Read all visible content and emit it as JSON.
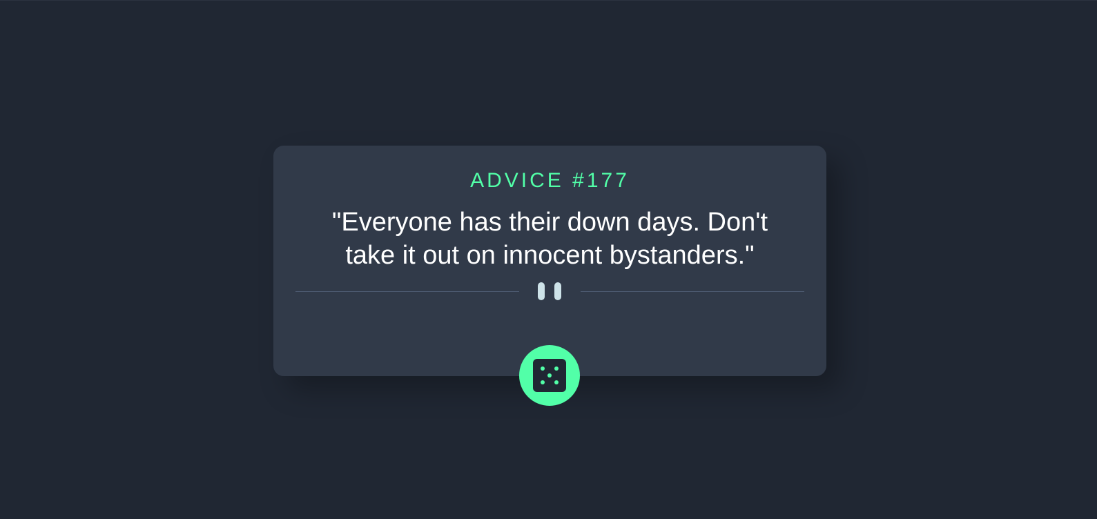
{
  "advice": {
    "id_label": "ADVICE #177",
    "quote": "\"Everyone has their down days. Don't take it out on innocent bystanders.\""
  },
  "icons": {
    "divider": "pause-icon",
    "button": "dice-icon"
  },
  "colors": {
    "background": "#202733",
    "card": "#313a49",
    "accent": "#52ffa8",
    "divider_line": "#4f5d74",
    "divider_icon": "#cee3e9",
    "text": "#ffffff"
  }
}
